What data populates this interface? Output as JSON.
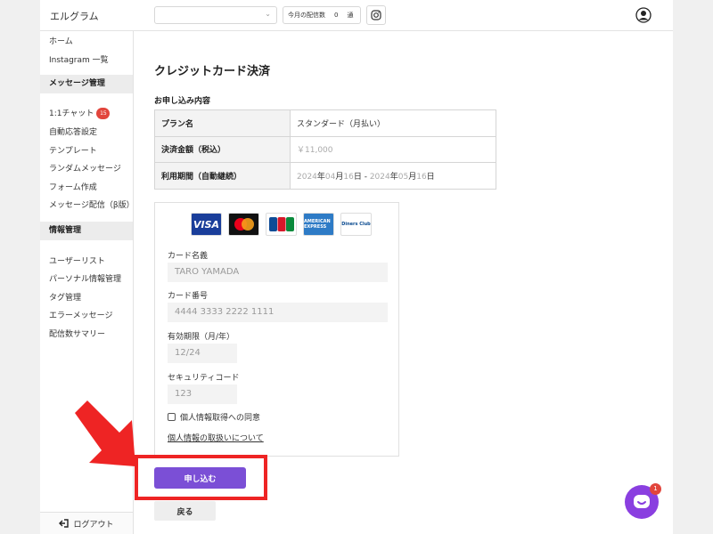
{
  "header": {
    "logo": "エルグラム",
    "account_select_value": "",
    "monthly_label": "今月の配信数",
    "monthly_count": "0",
    "monthly_unit": "通"
  },
  "sidebar": {
    "home": "ホーム",
    "instagram_list": "Instagram 一覧",
    "message_section": "メッセージ管理",
    "chat": "1:1チャット",
    "chat_badge": "15",
    "auto_reply": "自動応答設定",
    "template": "テンプレート",
    "random_message": "ランダムメッセージ",
    "form": "フォーム作成",
    "broadcast": "メッセージ配信（β版）",
    "info_section": "情報管理",
    "user_list": "ユーザーリスト",
    "personal_info": "パーソナル情報管理",
    "tag": "タグ管理",
    "error_message": "エラーメッセージ",
    "summary": "配信数サマリー",
    "logout": "ログアウト"
  },
  "main": {
    "title": "クレジットカード決済",
    "section_title": "お申し込み内容",
    "rows": [
      {
        "label": "プラン名",
        "value": "スタンダード（月払い）"
      },
      {
        "label": "決済金額（税込）",
        "value": "￥11,000"
      },
      {
        "label": "利用期間（自動継続）",
        "value_parts": [
          "2024",
          "年",
          "04",
          "月",
          "16",
          "日 - ",
          "2024",
          "年",
          "05",
          "月",
          "16",
          "日"
        ]
      }
    ]
  },
  "card_form": {
    "brands": [
      "VISA",
      "Mastercard",
      "JCB",
      "AMERICAN EXPRESS",
      "Diners Club"
    ],
    "name_label": "カード名義",
    "name_placeholder": "TARO YAMADA",
    "number_label": "カード番号",
    "number_placeholder": "4444 3333 2222 1111",
    "expiry_label": "有効期限（月/年）",
    "expiry_placeholder": "12/24",
    "cvc_label": "セキュリティコード",
    "cvc_placeholder": "123",
    "consent_label": "個人情報取得への同意",
    "consent_checked": false,
    "privacy_link": "個人情報の取扱いについて"
  },
  "buttons": {
    "apply": "申し込む",
    "back": "戻る"
  },
  "chat_widget": {
    "badge": "1"
  },
  "colors": {
    "primary": "#7b4fd6",
    "highlight": "#ee2424",
    "badge": "#e2453c"
  }
}
